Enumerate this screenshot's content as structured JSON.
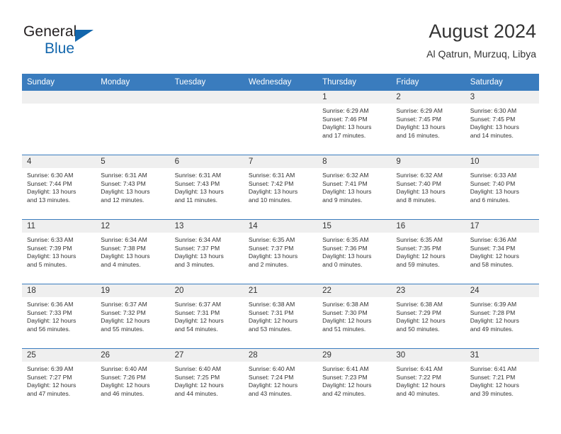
{
  "brand": {
    "word1": "General",
    "word2": "Blue",
    "triangle_icon": "triangle-icon",
    "accent_color": "#1266ac"
  },
  "header": {
    "title": "August 2024",
    "subtitle": "Al Qatrun, Murzuq, Libya"
  },
  "theme": {
    "header_bar": "#3a7cbe",
    "daynum_band": "#efefef",
    "text": "#333333"
  },
  "weekday_headers": [
    "Sunday",
    "Monday",
    "Tuesday",
    "Wednesday",
    "Thursday",
    "Friday",
    "Saturday"
  ],
  "labels": {
    "sunrise": "Sunrise:",
    "sunset": "Sunset:",
    "daylight": "Daylight:"
  },
  "weeks": [
    [
      {
        "blank": true
      },
      {
        "blank": true
      },
      {
        "blank": true
      },
      {
        "blank": true
      },
      {
        "day": "1",
        "sunrise": "Sunrise: 6:29 AM",
        "sunset": "Sunset: 7:46 PM",
        "daylight1": "Daylight: 13 hours",
        "daylight2": "and 17 minutes."
      },
      {
        "day": "2",
        "sunrise": "Sunrise: 6:29 AM",
        "sunset": "Sunset: 7:45 PM",
        "daylight1": "Daylight: 13 hours",
        "daylight2": "and 16 minutes."
      },
      {
        "day": "3",
        "sunrise": "Sunrise: 6:30 AM",
        "sunset": "Sunset: 7:45 PM",
        "daylight1": "Daylight: 13 hours",
        "daylight2": "and 14 minutes."
      }
    ],
    [
      {
        "day": "4",
        "sunrise": "Sunrise: 6:30 AM",
        "sunset": "Sunset: 7:44 PM",
        "daylight1": "Daylight: 13 hours",
        "daylight2": "and 13 minutes."
      },
      {
        "day": "5",
        "sunrise": "Sunrise: 6:31 AM",
        "sunset": "Sunset: 7:43 PM",
        "daylight1": "Daylight: 13 hours",
        "daylight2": "and 12 minutes."
      },
      {
        "day": "6",
        "sunrise": "Sunrise: 6:31 AM",
        "sunset": "Sunset: 7:43 PM",
        "daylight1": "Daylight: 13 hours",
        "daylight2": "and 11 minutes."
      },
      {
        "day": "7",
        "sunrise": "Sunrise: 6:31 AM",
        "sunset": "Sunset: 7:42 PM",
        "daylight1": "Daylight: 13 hours",
        "daylight2": "and 10 minutes."
      },
      {
        "day": "8",
        "sunrise": "Sunrise: 6:32 AM",
        "sunset": "Sunset: 7:41 PM",
        "daylight1": "Daylight: 13 hours",
        "daylight2": "and 9 minutes."
      },
      {
        "day": "9",
        "sunrise": "Sunrise: 6:32 AM",
        "sunset": "Sunset: 7:40 PM",
        "daylight1": "Daylight: 13 hours",
        "daylight2": "and 8 minutes."
      },
      {
        "day": "10",
        "sunrise": "Sunrise: 6:33 AM",
        "sunset": "Sunset: 7:40 PM",
        "daylight1": "Daylight: 13 hours",
        "daylight2": "and 6 minutes."
      }
    ],
    [
      {
        "day": "11",
        "sunrise": "Sunrise: 6:33 AM",
        "sunset": "Sunset: 7:39 PM",
        "daylight1": "Daylight: 13 hours",
        "daylight2": "and 5 minutes."
      },
      {
        "day": "12",
        "sunrise": "Sunrise: 6:34 AM",
        "sunset": "Sunset: 7:38 PM",
        "daylight1": "Daylight: 13 hours",
        "daylight2": "and 4 minutes."
      },
      {
        "day": "13",
        "sunrise": "Sunrise: 6:34 AM",
        "sunset": "Sunset: 7:37 PM",
        "daylight1": "Daylight: 13 hours",
        "daylight2": "and 3 minutes."
      },
      {
        "day": "14",
        "sunrise": "Sunrise: 6:35 AM",
        "sunset": "Sunset: 7:37 PM",
        "daylight1": "Daylight: 13 hours",
        "daylight2": "and 2 minutes."
      },
      {
        "day": "15",
        "sunrise": "Sunrise: 6:35 AM",
        "sunset": "Sunset: 7:36 PM",
        "daylight1": "Daylight: 13 hours",
        "daylight2": "and 0 minutes."
      },
      {
        "day": "16",
        "sunrise": "Sunrise: 6:35 AM",
        "sunset": "Sunset: 7:35 PM",
        "daylight1": "Daylight: 12 hours",
        "daylight2": "and 59 minutes."
      },
      {
        "day": "17",
        "sunrise": "Sunrise: 6:36 AM",
        "sunset": "Sunset: 7:34 PM",
        "daylight1": "Daylight: 12 hours",
        "daylight2": "and 58 minutes."
      }
    ],
    [
      {
        "day": "18",
        "sunrise": "Sunrise: 6:36 AM",
        "sunset": "Sunset: 7:33 PM",
        "daylight1": "Daylight: 12 hours",
        "daylight2": "and 56 minutes."
      },
      {
        "day": "19",
        "sunrise": "Sunrise: 6:37 AM",
        "sunset": "Sunset: 7:32 PM",
        "daylight1": "Daylight: 12 hours",
        "daylight2": "and 55 minutes."
      },
      {
        "day": "20",
        "sunrise": "Sunrise: 6:37 AM",
        "sunset": "Sunset: 7:31 PM",
        "daylight1": "Daylight: 12 hours",
        "daylight2": "and 54 minutes."
      },
      {
        "day": "21",
        "sunrise": "Sunrise: 6:38 AM",
        "sunset": "Sunset: 7:31 PM",
        "daylight1": "Daylight: 12 hours",
        "daylight2": "and 53 minutes."
      },
      {
        "day": "22",
        "sunrise": "Sunrise: 6:38 AM",
        "sunset": "Sunset: 7:30 PM",
        "daylight1": "Daylight: 12 hours",
        "daylight2": "and 51 minutes."
      },
      {
        "day": "23",
        "sunrise": "Sunrise: 6:38 AM",
        "sunset": "Sunset: 7:29 PM",
        "daylight1": "Daylight: 12 hours",
        "daylight2": "and 50 minutes."
      },
      {
        "day": "24",
        "sunrise": "Sunrise: 6:39 AM",
        "sunset": "Sunset: 7:28 PM",
        "daylight1": "Daylight: 12 hours",
        "daylight2": "and 49 minutes."
      }
    ],
    [
      {
        "day": "25",
        "sunrise": "Sunrise: 6:39 AM",
        "sunset": "Sunset: 7:27 PM",
        "daylight1": "Daylight: 12 hours",
        "daylight2": "and 47 minutes."
      },
      {
        "day": "26",
        "sunrise": "Sunrise: 6:40 AM",
        "sunset": "Sunset: 7:26 PM",
        "daylight1": "Daylight: 12 hours",
        "daylight2": "and 46 minutes."
      },
      {
        "day": "27",
        "sunrise": "Sunrise: 6:40 AM",
        "sunset": "Sunset: 7:25 PM",
        "daylight1": "Daylight: 12 hours",
        "daylight2": "and 44 minutes."
      },
      {
        "day": "28",
        "sunrise": "Sunrise: 6:40 AM",
        "sunset": "Sunset: 7:24 PM",
        "daylight1": "Daylight: 12 hours",
        "daylight2": "and 43 minutes."
      },
      {
        "day": "29",
        "sunrise": "Sunrise: 6:41 AM",
        "sunset": "Sunset: 7:23 PM",
        "daylight1": "Daylight: 12 hours",
        "daylight2": "and 42 minutes."
      },
      {
        "day": "30",
        "sunrise": "Sunrise: 6:41 AM",
        "sunset": "Sunset: 7:22 PM",
        "daylight1": "Daylight: 12 hours",
        "daylight2": "and 40 minutes."
      },
      {
        "day": "31",
        "sunrise": "Sunrise: 6:41 AM",
        "sunset": "Sunset: 7:21 PM",
        "daylight1": "Daylight: 12 hours",
        "daylight2": "and 39 minutes."
      }
    ]
  ]
}
